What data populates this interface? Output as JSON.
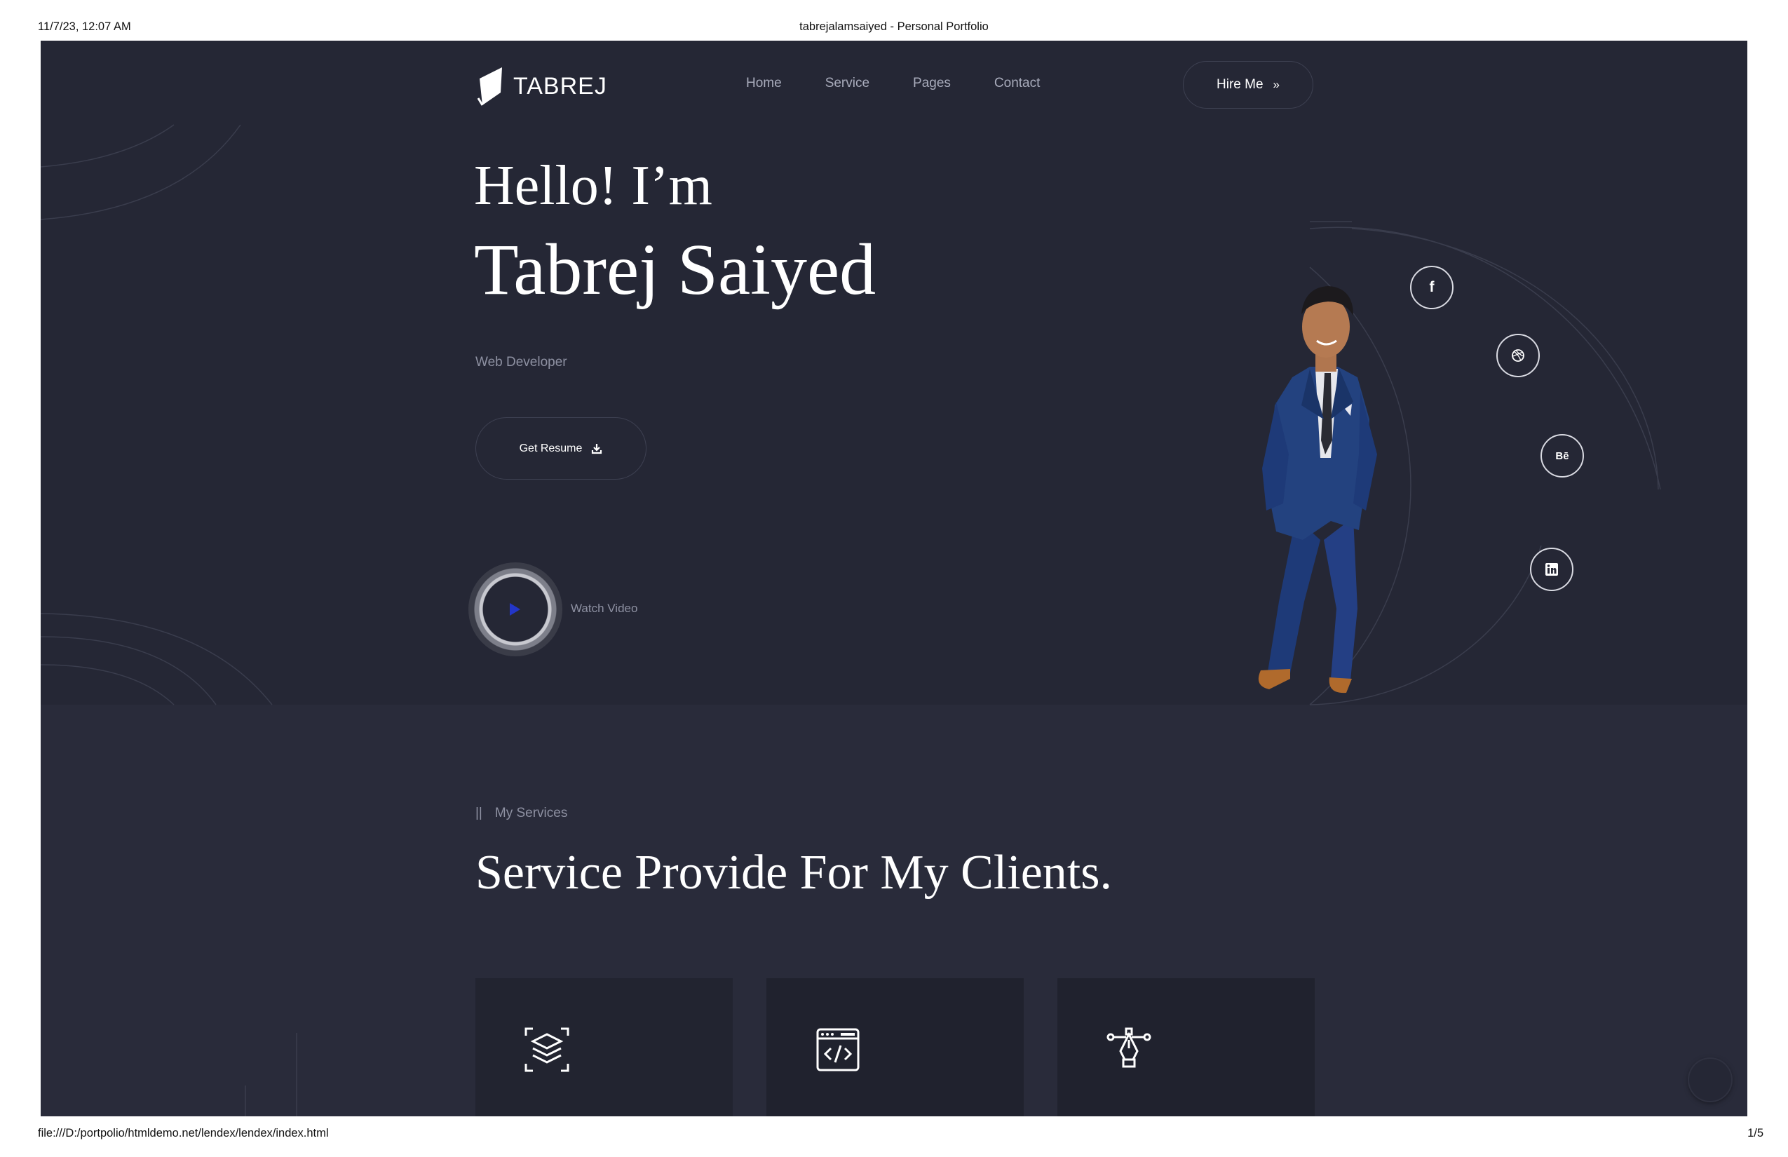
{
  "print": {
    "date": "11/7/23, 12:07 AM",
    "title": "tabrejalamsaiyed - Personal Portfolio",
    "url": "file:///D:/portpolio/htmldemo.net/lendex/lendex/index.html",
    "page": "1/5"
  },
  "header": {
    "logo_text": "TABREJ",
    "nav": [
      "Home",
      "Service",
      "Pages",
      "Contact"
    ],
    "hire_label": "Hire Me",
    "hire_icon": "»"
  },
  "hero": {
    "greeting": "Hello! I’m",
    "name": "Tabrej Saiyed",
    "role": "Web Developer",
    "resume_label": "Get Resume",
    "resume_icon": "download-icon",
    "watch_label": "Watch Video"
  },
  "socials": {
    "facebook": "f",
    "dribbble": "dribbble-icon",
    "behance": "Bē",
    "linkedin": "linkedin-icon"
  },
  "services": {
    "eyebrow_marker": "||",
    "eyebrow": "My Services",
    "heading": "Service Provide For My Clients.",
    "cards": [
      {
        "icon": "layers-icon"
      },
      {
        "icon": "code-window-icon"
      },
      {
        "icon": "pen-tool-icon"
      }
    ]
  },
  "colors": {
    "hero_bg": "#252735",
    "section_bg": "#292b3a",
    "card_bg": "#20222e",
    "text_primary": "#ffffff",
    "text_muted": "#8e91a2",
    "play_accent": "#2336c8"
  }
}
